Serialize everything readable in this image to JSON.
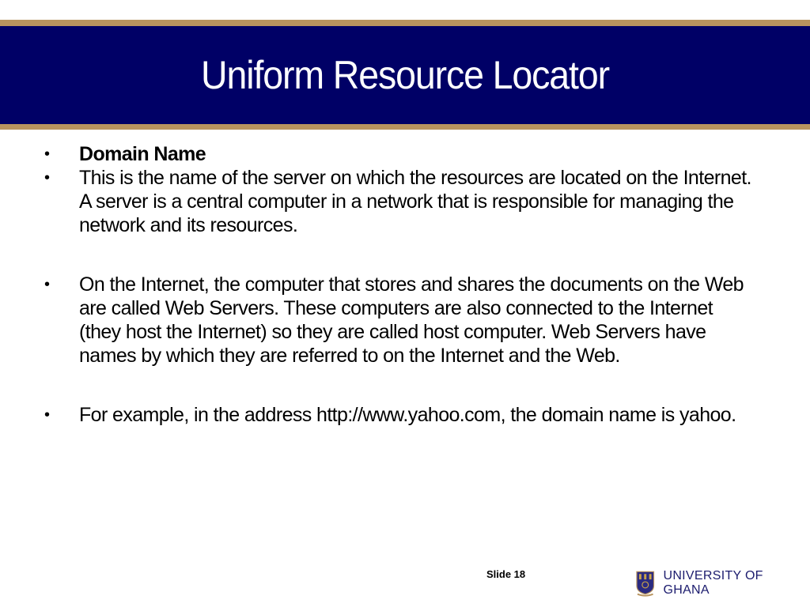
{
  "slide": {
    "title": "Uniform Resource Locator",
    "bullets": [
      {
        "symbol": "•",
        "text": "Domain Name",
        "bold": true
      },
      {
        "symbol": "•",
        "text": "This is the name of the server on which the resources are located on the Internet. A server is a central computer in a network that is responsible for managing the network and its resources."
      },
      {
        "symbol": "•",
        "text": "On the Internet, the computer that stores and shares the documents on the Web are called Web Servers. These computers are also connected to the Internet (they host the Internet) so they are called host computer. Web Servers have names by which they are referred to on the Internet and the Web."
      },
      {
        "symbol": "•",
        "text": "For example, in the address http://www.yahoo.com, the domain name is yahoo."
      }
    ],
    "slide_number": "Slide 18"
  },
  "footer": {
    "logo_icon": "university-crest-icon",
    "logo_text": "UNIVERSITY OF GHANA"
  },
  "colors": {
    "header_navy": "#000066",
    "accent_gold": "#b8945f",
    "logo_text": "#1c1c6e"
  }
}
